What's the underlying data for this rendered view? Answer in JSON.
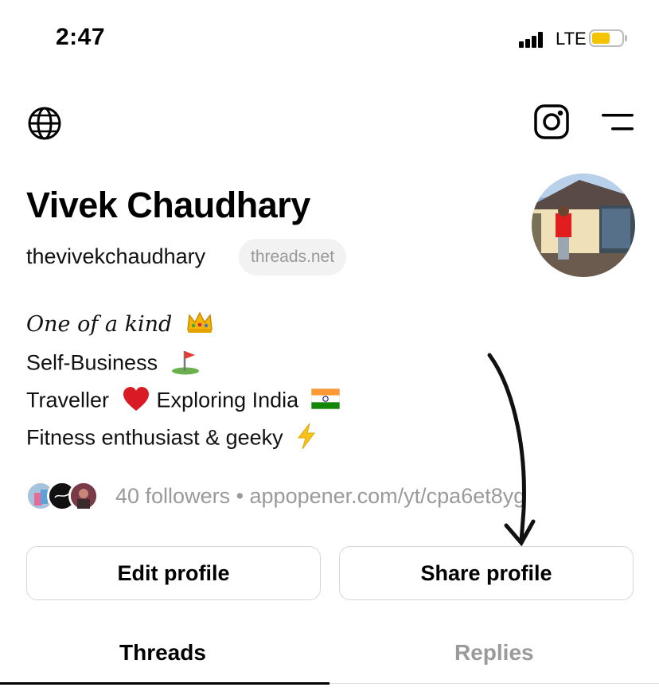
{
  "status_bar": {
    "time": "2:47",
    "network": "LTE",
    "battery_level": 0.6
  },
  "header": {
    "language_icon": "globe-icon",
    "instagram_icon": "instagram-icon",
    "menu_icon": "menu-icon"
  },
  "profile": {
    "name": "Vivek Chaudhary",
    "handle": "thevivekchaudhary",
    "domain_badge": "threads.net",
    "bio": {
      "line1": "One of a kind",
      "line2": "Self-Business",
      "line3a": "Traveller",
      "line3b": "Exploring India",
      "line4": "Fitness enthusiast & geeky"
    },
    "followers_line": "40 followers • appopener.com/yt/cpa6et8yg"
  },
  "actions": {
    "edit": "Edit profile",
    "share": "Share profile"
  },
  "tabs": {
    "threads": "Threads",
    "replies": "Replies"
  },
  "colors": {
    "battery": "#f5c400",
    "muted": "#9a9a9a",
    "border": "#d6d6d6"
  }
}
